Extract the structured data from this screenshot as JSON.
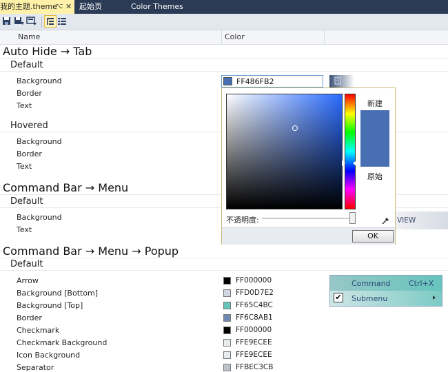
{
  "tabs": {
    "active_title": "我的主题.theme",
    "pin_glyph": "⌥",
    "close_glyph": "✕",
    "start_page": "起始页",
    "color_themes": "Color Themes"
  },
  "header": {
    "name": "Name",
    "color": "Color"
  },
  "sections": {
    "s1": {
      "title": "Auto Hide → Tab",
      "default": "Default",
      "default_items": [
        "Background",
        "Border",
        "Text"
      ],
      "hovered": "Hovered",
      "hovered_items": [
        "Background",
        "Border",
        "Text"
      ]
    },
    "s2": {
      "title": "Command Bar → Menu",
      "default": "Default",
      "default_items": [
        "Background",
        "Text"
      ]
    },
    "s3": {
      "title": "Command Bar → Menu → Popup",
      "default": "Default",
      "rows": [
        {
          "label": "Arrow",
          "value": "FF000000",
          "color": "#000000"
        },
        {
          "label": "Background [Bottom]",
          "value": "FFD0D7E2",
          "color": "#D0D7E2"
        },
        {
          "label": "Background [Top]",
          "value": "FF65C4BC",
          "color": "#65C4BC"
        },
        {
          "label": "Border",
          "value": "FF6C8AB1",
          "color": "#6C8AB1"
        },
        {
          "label": "Checkmark",
          "value": "FF000000",
          "color": "#000000"
        },
        {
          "label": "Checkmark Background",
          "value": "FFE9ECEE",
          "color": "#E9ECEE"
        },
        {
          "label": "Icon Background",
          "value": "FFE9ECEE",
          "color": "#E9ECEE"
        },
        {
          "label": "Separator",
          "value": "FFBEC3CB",
          "color": "#BEC3CB"
        }
      ]
    }
  },
  "selected_color": {
    "value": "FF486FB2",
    "color": "#486FB2"
  },
  "picker": {
    "new_label": "新建",
    "original_label": "原始",
    "opacity_label": "不透明度:",
    "opacity": 1.0,
    "ok": "OK"
  },
  "preview": {
    "view_text": "VIEW",
    "menu_command": "Command",
    "menu_shortcut": "Ctrl+X",
    "menu_submenu": "Submenu",
    "checkmark": "✔"
  },
  "colors": {
    "accent": "#486FB2",
    "tab_bg": "#2B3A55",
    "active_tab": "#FFF2A8"
  }
}
